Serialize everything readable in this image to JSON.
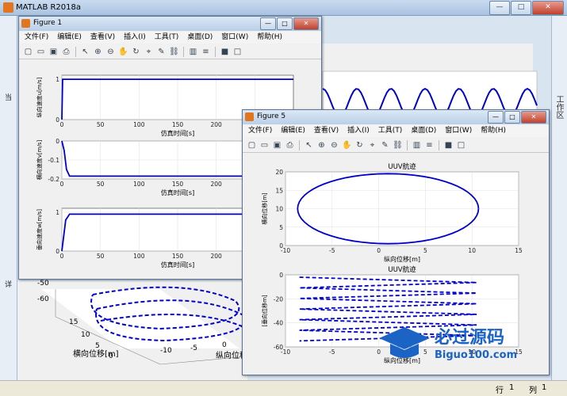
{
  "matlab": {
    "title": "MATLAB R2018a",
    "right_panel_label": "工作区",
    "left_chars": [
      "当",
      "详"
    ],
    "status": {
      "row_label": "行",
      "row_value": "1",
      "col_label": "列",
      "col_value": "1"
    }
  },
  "menus": [
    "文件(F)",
    "编辑(E)",
    "查看(V)",
    "插入(I)",
    "工具(T)",
    "桌面(D)",
    "窗口(W)",
    "帮助(H)"
  ],
  "toolbar_icons": [
    "new-icon",
    "open-icon",
    "save-icon",
    "print-icon",
    "pointer-icon",
    "zoom-in-icon",
    "zoom-out-icon",
    "pan-icon",
    "rotate-icon",
    "data-cursor-icon",
    "brush-icon",
    "link-icon",
    "colorbar-icon",
    "legend-icon",
    "hide-plot-icon",
    "show-plot-icon"
  ],
  "figure1": {
    "title": "Figure 1",
    "plots": [
      {
        "ylabel": "纵向速度u[m/s]",
        "xlabel": "仿真时间[s]",
        "yticks": [
          "0",
          "1"
        ],
        "xticks": [
          "0",
          "50",
          "100",
          "150",
          "200",
          "250"
        ]
      },
      {
        "ylabel": "横向速度v[m/s]",
        "xlabel": "仿真时间[s]",
        "yticks": [
          "0",
          "-0.1",
          "-0.2"
        ],
        "xticks": [
          "0",
          "50",
          "100",
          "150",
          "200",
          "250"
        ]
      },
      {
        "ylabel": "垂向速度w[m/s]",
        "xlabel": "仿真时间[s]",
        "yticks": [
          "0",
          "1"
        ],
        "xticks": [
          "0",
          "50",
          "100",
          "150",
          "200",
          "250"
        ]
      }
    ]
  },
  "figure5": {
    "title": "Figure 5",
    "plots": [
      {
        "title": "UUV航迹",
        "ylabel": "横向位移[m]",
        "xlabel": "纵向位移[m]",
        "yticks": [
          "20",
          "15",
          "10",
          "5",
          "0"
        ],
        "xticks": [
          "-10",
          "-5",
          "0",
          "5",
          "10",
          "15"
        ]
      },
      {
        "title": "UUV航迹",
        "ylabel": "[垂向位移m]",
        "xlabel": "纵向位移[m]",
        "yticks": [
          "0",
          "-20",
          "-40",
          "-60"
        ],
        "xticks": [
          "-10",
          "-5",
          "0",
          "5",
          "10",
          "15"
        ]
      }
    ]
  },
  "background_3d": {
    "xlabel": "横向位移[m]",
    "ylabel": "纵向位移[m]",
    "zticks": [
      "-50",
      "-60"
    ],
    "yticks": [
      "15",
      "10",
      "5",
      "0"
    ],
    "xticks": [
      "-10",
      "-5",
      "0"
    ]
  },
  "watermark": {
    "text": "必过源码",
    "url": "Biguo100.com"
  },
  "chart_data": [
    {
      "type": "line",
      "title": "",
      "xlabel": "仿真时间[s]",
      "ylabel": "纵向速度u[m/s]",
      "x": [
        0,
        1,
        3,
        300
      ],
      "y": [
        0,
        1,
        1,
        1
      ],
      "xlim": [
        0,
        300
      ],
      "ylim": [
        0,
        1.1
      ]
    },
    {
      "type": "line",
      "title": "",
      "xlabel": "仿真时间[s]",
      "ylabel": "横向速度v[m/s]",
      "x": [
        0,
        3,
        6,
        10,
        20,
        300
      ],
      "y": [
        0,
        -0.05,
        -0.15,
        -0.185,
        -0.185,
        -0.185
      ],
      "xlim": [
        0,
        300
      ],
      "ylim": [
        -0.2,
        0
      ]
    },
    {
      "type": "line",
      "title": "",
      "xlabel": "仿真时间[s]",
      "ylabel": "垂向速度w[m/s]",
      "x": [
        0,
        5,
        10,
        300
      ],
      "y": [
        0,
        0.8,
        0.95,
        0.95
      ],
      "xlim": [
        0,
        300
      ],
      "ylim": [
        0,
        1.1
      ]
    },
    {
      "type": "line",
      "title": "UUV航迹",
      "xlabel": "纵向位移[m]",
      "ylabel": "横向位移[m]",
      "shape": "ellipse",
      "center": [
        1,
        10
      ],
      "radius": [
        9.7,
        9.5
      ],
      "xlim": [
        -10,
        15
      ],
      "ylim": [
        0,
        20
      ]
    },
    {
      "type": "line",
      "title": "UUV航迹",
      "xlabel": "纵向位移[m]",
      "ylabel": "[垂向位移m]",
      "pattern": "zigzag",
      "x_range": [
        -8.5,
        10.5
      ],
      "y_start": -2,
      "y_end": -55,
      "turns": 12,
      "xlim": [
        -10,
        15
      ],
      "ylim": [
        -60,
        0
      ]
    }
  ]
}
